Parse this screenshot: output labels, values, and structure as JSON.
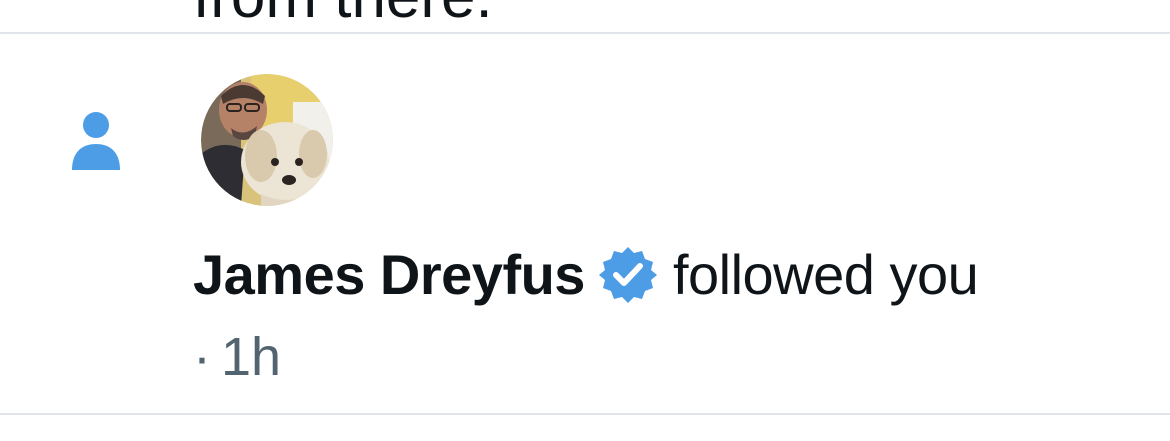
{
  "previous_item": {
    "tail_text": "from there."
  },
  "notification": {
    "type_icon": "person-icon",
    "user": {
      "name": "James Dreyfus",
      "verified": true,
      "avatar_alt": "James Dreyfus"
    },
    "action_text": "followed you",
    "separator": "·",
    "timestamp": "1h"
  },
  "colors": {
    "accent": "#4d9ce6",
    "text_primary": "#0f1419",
    "text_secondary": "#536471",
    "divider": "#e1e4e8"
  }
}
